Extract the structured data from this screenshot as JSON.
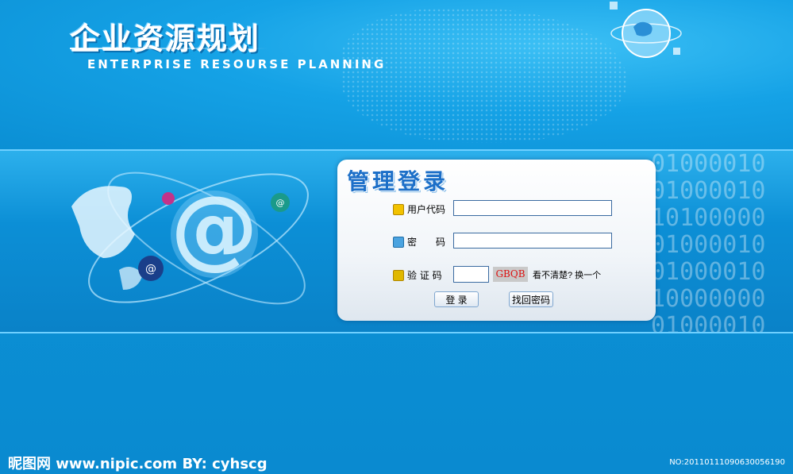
{
  "header": {
    "title_cn": "企业资源规划",
    "title_en": "ENTERPRISE RESOURSE PLANNING"
  },
  "login": {
    "panel_title": "管理登录",
    "username_label": "用户代码",
    "password_label": "密　　码",
    "captcha_label": "验 证 码",
    "username_value": "",
    "password_value": "",
    "captcha_value": "",
    "captcha_code": "GBQB",
    "captcha_hint": "看不清楚? 换一个",
    "login_button": "登 录",
    "recover_button": "找回密码"
  },
  "band": {
    "binary_text": "01000010\n01000010\n10100000\n01000010\n01000010\n10000000\n01000010"
  },
  "footer": {
    "watermark": "昵图网 www.nipic.com   BY: cyhscg",
    "id_text": "NO:20110111090630056190"
  },
  "colors": {
    "background": "#0b8fd4",
    "panel_title": "#1c6fc8",
    "captcha_text": "#dd1111"
  }
}
